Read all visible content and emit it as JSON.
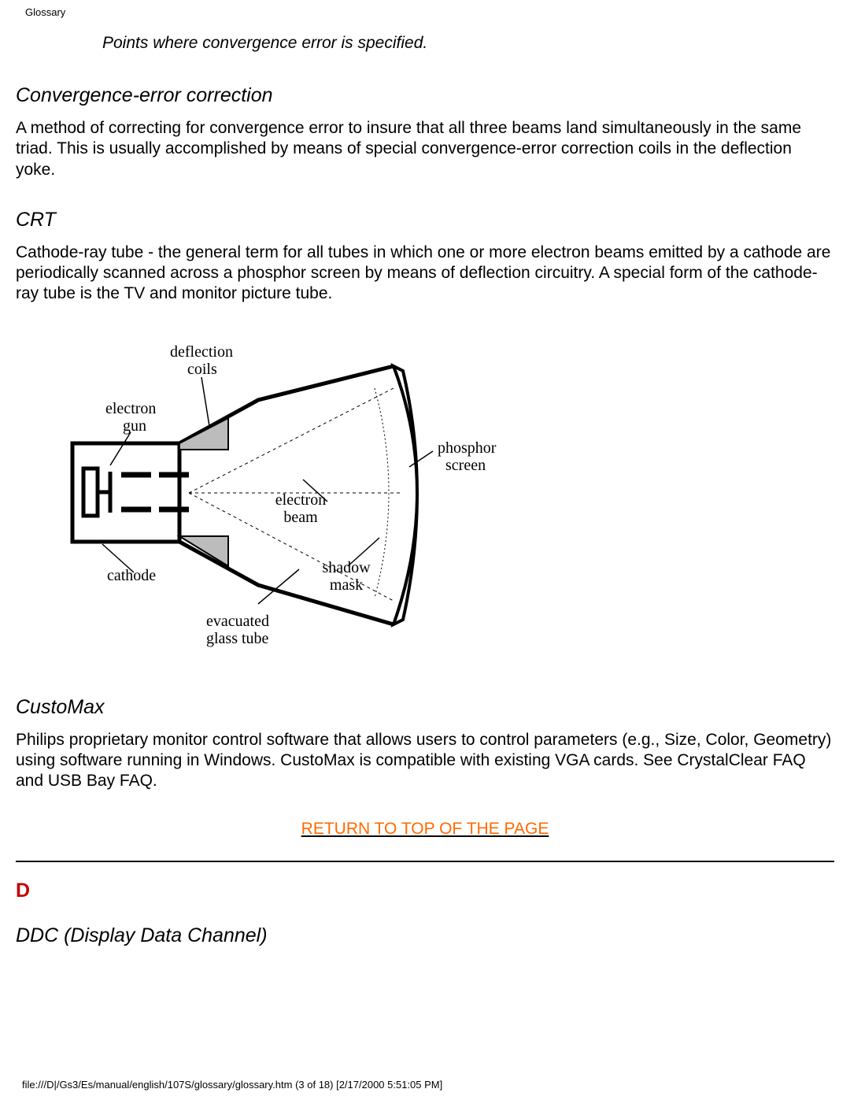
{
  "header": {
    "title": "Glossary"
  },
  "caption": "Points where convergence error is specified.",
  "entries": {
    "convergence": {
      "title": "Convergence-error correction",
      "body": "A method of correcting for convergence error to insure that all three beams land simultaneously in the same triad. This is usually accomplished by means of special convergence-error correction coils in the deflection yoke."
    },
    "crt": {
      "title": "CRT",
      "body": "Cathode-ray tube - the general term for all tubes in which one or more electron beams emitted by a cathode are periodically scanned across a phosphor screen by means of deflection circuitry. A special form of the cathode-ray tube is the TV and monitor picture tube."
    },
    "customax": {
      "title": "CustoMax",
      "body": "Philips proprietary monitor control software that allows users to control parameters (e.g., Size, Color, Geometry) using software running in Windows. CustoMax is compatible with existing VGA cards. See CrystalClear FAQ and USB Bay FAQ."
    },
    "ddc": {
      "title": "DDC (Display Data Channel)"
    }
  },
  "diagram": {
    "labels": {
      "deflection_coils_1": "deflection",
      "deflection_coils_2": "coils",
      "electron_gun_1": "electron",
      "electron_gun_2": "gun",
      "phosphor_1": "phosphor",
      "phosphor_2": "screen",
      "electron_beam_1": "electron",
      "electron_beam_2": "beam",
      "cathode": "cathode",
      "shadow_mask_1": "shadow",
      "shadow_mask_2": "mask",
      "evacuated_1": "evacuated",
      "evacuated_2": "glass tube"
    }
  },
  "section_letter": "D",
  "return_link": "RETURN TO TOP OF THE PAGE",
  "footer": "file:///D|/Gs3/Es/manual/english/107S/glossary/glossary.htm (3 of 18) [2/17/2000 5:51:05 PM]"
}
